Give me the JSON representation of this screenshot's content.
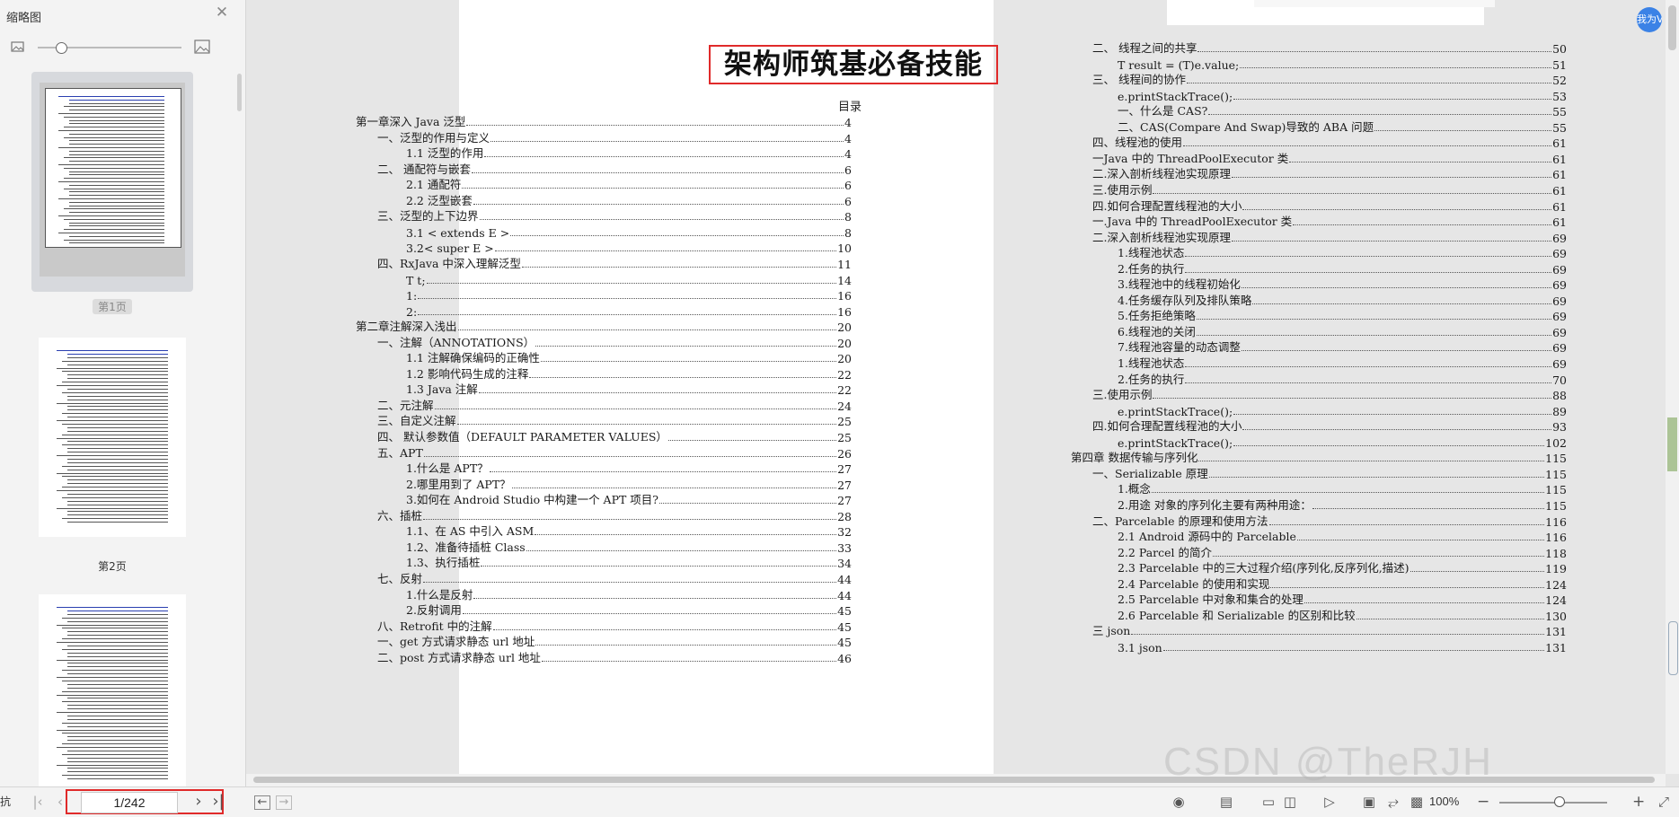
{
  "sidebar": {
    "title": "缩略图",
    "thumbnails": [
      {
        "label": "第1页",
        "selected": true
      },
      {
        "label": "第2页",
        "selected": false
      },
      {
        "label": "",
        "selected": false
      }
    ]
  },
  "document": {
    "title": "架构师筑基必备技能",
    "toc_heading": "目录",
    "left_column": [
      {
        "text": "第一章深入 Java 泛型",
        "page": "4",
        "level": 0
      },
      {
        "text": "一、泛型的作用与定义",
        "page": "4",
        "level": 1
      },
      {
        "text": "1.1 泛型的作用",
        "page": "4",
        "level": 2
      },
      {
        "text": "二、 通配符与嵌套",
        "page": "6",
        "level": 1
      },
      {
        "text": "2.1 通配符",
        "page": "6",
        "level": 2
      },
      {
        "text": "2.2 泛型嵌套",
        "page": "6",
        "level": 2
      },
      {
        "text": "三、泛型的上下边界",
        "page": "8",
        "level": 1
      },
      {
        "text": "3.1 < extends E >",
        "page": "8",
        "level": 2
      },
      {
        "text": "3.2< super E >",
        "page": "10",
        "level": 2
      },
      {
        "text": "四、RxJava 中深入理解泛型",
        "page": "11",
        "level": 1
      },
      {
        "text": "T t;",
        "page": "14",
        "level": 2
      },
      {
        "text": "1:",
        "page": "16",
        "level": 2
      },
      {
        "text": "2:",
        "page": "16",
        "level": 2
      },
      {
        "text": "第二章注解深入浅出",
        "page": "20",
        "level": 0
      },
      {
        "text": "一、注解（ANNOTATIONS）",
        "page": "20",
        "level": 1
      },
      {
        "text": "1.1 注解确保编码的正确性",
        "page": "20",
        "level": 2
      },
      {
        "text": "1.2 影响代码生成的注释",
        "page": "22",
        "level": 2
      },
      {
        "text": "1.3 Java 注解",
        "page": "22",
        "level": 2
      },
      {
        "text": "二、元注解",
        "page": "24",
        "level": 1
      },
      {
        "text": "三、自定义注解",
        "page": "25",
        "level": 1
      },
      {
        "text": "四、 默认参数值（DEFAULT PARAMETER VALUES）",
        "page": "25",
        "level": 1
      },
      {
        "text": "五、APT",
        "page": "26",
        "level": 1
      },
      {
        "text": "1.什么是 APT？",
        "page": "27",
        "level": 2
      },
      {
        "text": "2.哪里用到了 APT？",
        "page": "27",
        "level": 2
      },
      {
        "text": "3.如何在 Android Studio 中构建一个 APT 项目?",
        "page": "27",
        "level": 2
      },
      {
        "text": "六、插桩",
        "page": "28",
        "level": 1
      },
      {
        "text": "1.1、在 AS 中引入 ASM",
        "page": "32",
        "level": 2
      },
      {
        "text": "1.2、准备待插桩 Class",
        "page": "33",
        "level": 2
      },
      {
        "text": "1.3、执行插桩",
        "page": "34",
        "level": 2
      },
      {
        "text": "七、反射",
        "page": "44",
        "level": 1
      },
      {
        "text": "1.什么是反射",
        "page": "44",
        "level": 2
      },
      {
        "text": "2.反射调用",
        "page": "45",
        "level": 2
      },
      {
        "text": "八、Retrofit 中的注解",
        "page": "45",
        "level": 1
      },
      {
        "text": "一、get 方式请求静态 url 地址",
        "page": "45",
        "level": 1
      },
      {
        "text": "二、post 方式请求静态 url 地址",
        "page": "46",
        "level": 1
      }
    ],
    "right_column": [
      {
        "text": "二、 线程之间的共享",
        "page": "50",
        "level": 1
      },
      {
        "text": "T result = (T)e.value;",
        "page": "51",
        "level": 2
      },
      {
        "text": "三、 线程间的协作",
        "page": "52",
        "level": 1
      },
      {
        "text": "e.printStackTrace();",
        "page": "53",
        "level": 2
      },
      {
        "text": "一、什么是 CAS?",
        "page": "55",
        "level": 2
      },
      {
        "text": "二、CAS(Compare And Swap)导致的 ABA 问题",
        "page": "55",
        "level": 2
      },
      {
        "text": "四、线程池的使用",
        "page": "61",
        "level": 1
      },
      {
        "text": "一Java 中的 ThreadPoolExecutor 类",
        "page": "61",
        "level": 1
      },
      {
        "text": "二.深入剖析线程池实现原理",
        "page": "61",
        "level": 1
      },
      {
        "text": "三.使用示例",
        "page": "61",
        "level": 1
      },
      {
        "text": "四.如何合理配置线程池的大小",
        "page": "61",
        "level": 1
      },
      {
        "text": "一.Java 中的 ThreadPoolExecutor 类",
        "page": "61",
        "level": 1
      },
      {
        "text": "二.深入剖析线程池实现原理",
        "page": "69",
        "level": 1
      },
      {
        "text": "1.线程池状态",
        "page": "69",
        "level": 2
      },
      {
        "text": "2.任务的执行",
        "page": "69",
        "level": 2
      },
      {
        "text": "3.线程池中的线程初始化",
        "page": "69",
        "level": 2
      },
      {
        "text": "4.任务缓存队列及排队策略",
        "page": "69",
        "level": 2
      },
      {
        "text": "5.任务拒绝策略",
        "page": "69",
        "level": 2
      },
      {
        "text": "6.线程池的关闭",
        "page": "69",
        "level": 2
      },
      {
        "text": "7.线程池容量的动态调整",
        "page": "69",
        "level": 2
      },
      {
        "text": "1.线程池状态",
        "page": "69",
        "level": 2
      },
      {
        "text": "2.任务的执行",
        "page": "70",
        "level": 2
      },
      {
        "text": "三.使用示例",
        "page": "88",
        "level": 1
      },
      {
        "text": "e.printStackTrace();",
        "page": "89",
        "level": 2
      },
      {
        "text": "四.如何合理配置线程池的大小",
        "page": "93",
        "level": 1
      },
      {
        "text": "e.printStackTrace();",
        "page": "102",
        "level": 2
      },
      {
        "text": "第四章 数据传输与序列化",
        "page": "115",
        "level": 0
      },
      {
        "text": "一、Serializable 原理",
        "page": "115",
        "level": 1
      },
      {
        "text": "1.概念",
        "page": "115",
        "level": 2
      },
      {
        "text": "2.用途 对象的序列化主要有两种用途：",
        "page": "115",
        "level": 2
      },
      {
        "text": "二、Parcelable 的原理和使用方法",
        "page": "116",
        "level": 1
      },
      {
        "text": "2.1 Android 源码中的 Parcelable",
        "page": "116",
        "level": 2
      },
      {
        "text": "2.2 Parcel 的简介",
        "page": "118",
        "level": 2
      },
      {
        "text": "2.3 Parcelable 中的三大过程介绍(序列化,反序列化,描述)",
        "page": "119",
        "level": 2
      },
      {
        "text": "2.4 Parcelable 的使用和实现",
        "page": "124",
        "level": 2
      },
      {
        "text": "2.5 Parcelable 中对象和集合的处理",
        "page": "124",
        "level": 2
      },
      {
        "text": "2.6 Parcelable 和 Serializable 的区别和比较",
        "page": "130",
        "level": 2
      },
      {
        "text": "三 json",
        "page": "131",
        "level": 1
      },
      {
        "text": "3.1 json",
        "page": "131",
        "level": 2
      }
    ]
  },
  "avatar": {
    "text": "我为V"
  },
  "statusbar": {
    "current_page": "1/242",
    "zoom": "100%",
    "left_glyph": "抗"
  },
  "watermark": "CSDN @TheRJH",
  "icons": {
    "close": "close-icon",
    "zoom_out_thumb": "image-small-icon",
    "zoom_in_thumb": "image-large-icon"
  }
}
